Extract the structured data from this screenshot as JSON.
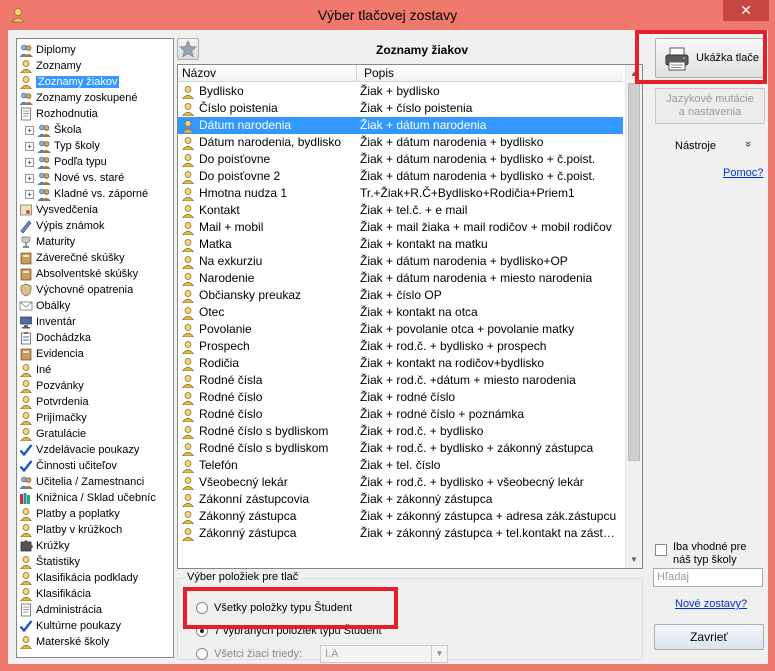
{
  "window": {
    "title": "Výber tlačovej zostavy",
    "close_glyph": "✕"
  },
  "tree": {
    "items": [
      {
        "label": "Diplomy",
        "icon": "people-icon",
        "level": 0,
        "expander": false,
        "selected": false
      },
      {
        "label": "Zoznamy",
        "icon": "student-icon",
        "level": 0,
        "expander": false,
        "selected": false
      },
      {
        "label": "Zoznamy žiakov",
        "icon": "student-icon",
        "level": 0,
        "expander": false,
        "selected": true
      },
      {
        "label": "Zoznamy zoskupené",
        "icon": "people-icon",
        "level": 0,
        "expander": false,
        "selected": false
      },
      {
        "label": "Rozhodnutia",
        "icon": "document-icon",
        "level": 0,
        "expander": false,
        "selected": false
      },
      {
        "label": "Škola",
        "icon": "people-icon",
        "level": 1,
        "expander": true,
        "selected": false
      },
      {
        "label": "Typ školy",
        "icon": "people-icon",
        "level": 1,
        "expander": true,
        "selected": false
      },
      {
        "label": "Podľa typu",
        "icon": "people-icon",
        "level": 1,
        "expander": true,
        "selected": false
      },
      {
        "label": "Nové vs. staré",
        "icon": "people-icon",
        "level": 1,
        "expander": true,
        "selected": false
      },
      {
        "label": "Kladné vs. záporné",
        "icon": "people-icon",
        "level": 1,
        "expander": true,
        "selected": false
      },
      {
        "label": "Vysvedčenia",
        "icon": "certificate-icon",
        "level": 0,
        "expander": false,
        "selected": false
      },
      {
        "label": "Výpis známok",
        "icon": "pen-icon",
        "level": 0,
        "expander": false,
        "selected": false
      },
      {
        "label": "Maturity",
        "icon": "trophy-icon",
        "level": 0,
        "expander": false,
        "selected": false
      },
      {
        "label": "Záverečné skúšky",
        "icon": "book-icon",
        "level": 0,
        "expander": false,
        "selected": false
      },
      {
        "label": "Absolventské skúšky",
        "icon": "book-icon",
        "level": 0,
        "expander": false,
        "selected": false
      },
      {
        "label": "Výchovné opatrenia",
        "icon": "shield-icon",
        "level": 0,
        "expander": false,
        "selected": false
      },
      {
        "label": "Obálky",
        "icon": "envelope-icon",
        "level": 0,
        "expander": false,
        "selected": false
      },
      {
        "label": "Inventár",
        "icon": "computer-icon",
        "level": 0,
        "expander": false,
        "selected": false
      },
      {
        "label": "Dochádzka",
        "icon": "clipboard-icon",
        "level": 0,
        "expander": false,
        "selected": false
      },
      {
        "label": "Evidencia",
        "icon": "book-icon",
        "level": 0,
        "expander": false,
        "selected": false
      },
      {
        "label": "Iné",
        "icon": "student-icon",
        "level": 0,
        "expander": false,
        "selected": false
      },
      {
        "label": "Pozvánky",
        "icon": "student-icon",
        "level": 0,
        "expander": false,
        "selected": false
      },
      {
        "label": "Potvrdenia",
        "icon": "student-icon",
        "level": 0,
        "expander": false,
        "selected": false
      },
      {
        "label": "Prijímačky",
        "icon": "student-icon",
        "level": 0,
        "expander": false,
        "selected": false
      },
      {
        "label": "Gratulácie",
        "icon": "student-icon",
        "level": 0,
        "expander": false,
        "selected": false
      },
      {
        "label": "Vzdelávacie poukazy",
        "icon": "check-icon",
        "level": 0,
        "expander": false,
        "selected": false
      },
      {
        "label": "Činnosti učiteľov",
        "icon": "check-icon",
        "level": 0,
        "expander": false,
        "selected": false
      },
      {
        "label": "Učitelia / Zamestnanci",
        "icon": "people-icon",
        "level": 0,
        "expander": false,
        "selected": false
      },
      {
        "label": "Knižnica / Sklad učebníc",
        "icon": "books-icon",
        "level": 0,
        "expander": false,
        "selected": false
      },
      {
        "label": "Platby a poplatky",
        "icon": "student-icon",
        "level": 0,
        "expander": false,
        "selected": false
      },
      {
        "label": "Platby v krúžkoch",
        "icon": "student-icon",
        "level": 0,
        "expander": false,
        "selected": false
      },
      {
        "label": "Krúžky",
        "icon": "puzzle-icon",
        "level": 0,
        "expander": false,
        "selected": false
      },
      {
        "label": "Štatistiky",
        "icon": "student-icon",
        "level": 0,
        "expander": false,
        "selected": false
      },
      {
        "label": "Klasifikácia podklady",
        "icon": "student-icon",
        "level": 0,
        "expander": false,
        "selected": false
      },
      {
        "label": "Klasifikácia",
        "icon": "student-icon",
        "level": 0,
        "expander": false,
        "selected": false
      },
      {
        "label": "Administrácia",
        "icon": "document-icon",
        "level": 0,
        "expander": false,
        "selected": false
      },
      {
        "label": "Kultúrne poukazy",
        "icon": "check-icon",
        "level": 0,
        "expander": false,
        "selected": false
      },
      {
        "label": "Materské školy",
        "icon": "student-icon",
        "level": 0,
        "expander": false,
        "selected": false
      }
    ]
  },
  "list": {
    "title": "Zoznamy žiakov",
    "col_name": "Názov",
    "col_desc": "Popis",
    "rows": [
      {
        "name": "Bydlisko",
        "desc": "Žiak + bydlisko",
        "selected": false
      },
      {
        "name": "Číslo poistenia",
        "desc": "Žiak + číslo poistenia",
        "selected": false
      },
      {
        "name": "Dátum narodenia",
        "desc": "Žiak + dátum narodenia",
        "selected": true
      },
      {
        "name": "Dátum narodenia, bydlisko",
        "desc": "Žiak + dátum narodenia + bydlisko",
        "selected": false
      },
      {
        "name": "Do poisťovne",
        "desc": "Žiak + dátum narodenia + bydlisko + č.poist.",
        "selected": false
      },
      {
        "name": "Do poisťovne 2",
        "desc": "Žiak + dátum narodenia + bydlisko + č.poist.",
        "selected": false
      },
      {
        "name": "Hmotna nudza 1",
        "desc": "Tr.+Žiak+R.Č+Bydlisko+Rodičia+Priem1",
        "selected": false
      },
      {
        "name": "Kontakt",
        "desc": "Žiak + tel.č. + e mail",
        "selected": false
      },
      {
        "name": "Mail + mobil",
        "desc": "Žiak + mail žiaka + mail rodičov + mobil rodičov",
        "selected": false
      },
      {
        "name": "Matka",
        "desc": "Žiak + kontakt na matku",
        "selected": false
      },
      {
        "name": "Na exkurziu",
        "desc": "Žiak + dátum narodenia + bydlisko+OP",
        "selected": false
      },
      {
        "name": "Narodenie",
        "desc": "Žiak + dátum narodenia + miesto narodenia",
        "selected": false
      },
      {
        "name": "Občiansky preukaz",
        "desc": "Žiak + číslo OP",
        "selected": false
      },
      {
        "name": "Otec",
        "desc": "Žiak + kontakt na otca",
        "selected": false
      },
      {
        "name": "Povolanie",
        "desc": "Žiak + povolanie otca + povolanie matky",
        "selected": false
      },
      {
        "name": "Prospech",
        "desc": "Žiak + rod.č. + bydlisko + prospech",
        "selected": false
      },
      {
        "name": "Rodičia",
        "desc": "Žiak + kontakt na rodičov+bydlisko",
        "selected": false
      },
      {
        "name": "Rodné čísla",
        "desc": "Žiak + rod.č. +dátum + miesto narodenia",
        "selected": false
      },
      {
        "name": "Rodné číslo",
        "desc": "Žiak + rodné číslo",
        "selected": false
      },
      {
        "name": "Rodné číslo",
        "desc": "Žiak + rodné číslo + poznámka",
        "selected": false
      },
      {
        "name": "Rodné číslo s bydliskom",
        "desc": "Žiak + rod.č. + bydlisko",
        "selected": false
      },
      {
        "name": "Rodné číslo s bydliskom",
        "desc": "Žiak + rod.č. + bydlisko + zákonný zástupca",
        "selected": false
      },
      {
        "name": "Telefón",
        "desc": "Žiak + tel. číslo",
        "selected": false
      },
      {
        "name": "Všeobecný lekár",
        "desc": "Žiak + rod.č. + bydlisko + všeobecný lekár",
        "selected": false
      },
      {
        "name": "Zákonní zástupcovia",
        "desc": "Žiak + zákonný zástupca",
        "selected": false
      },
      {
        "name": "Zákonný zástupca",
        "desc": "Žiak + zákonný zástupca + adresa zák.zástupcu",
        "selected": false
      },
      {
        "name": "Zákonný zástupca",
        "desc": "Žiak + zákonný zástupca + tel.kontakt na zástupcu",
        "selected": false
      }
    ]
  },
  "selection": {
    "title": "Výber položiek pre tlač",
    "option_all": "Všetky položky typu Študent",
    "option_selected": "7 vybraných položiek typu Študent",
    "option_class": "Všetci žiaci triedy:",
    "class_value": "I.A"
  },
  "right": {
    "preview_label": "Ukážka tlače",
    "language_label_1": "Jazykové mutácie",
    "language_label_2": "a nastavenia",
    "tools_label": "Nástroje",
    "tools_chevron": "»",
    "help_link": "Pomoc?",
    "only_suitable_1": "Iba vhodné pre",
    "only_suitable_2": "náš typ školy",
    "search_placeholder": "Hľadaj",
    "new_reports_link": "Nové zostavy?",
    "close_label": "Zavrieť"
  }
}
